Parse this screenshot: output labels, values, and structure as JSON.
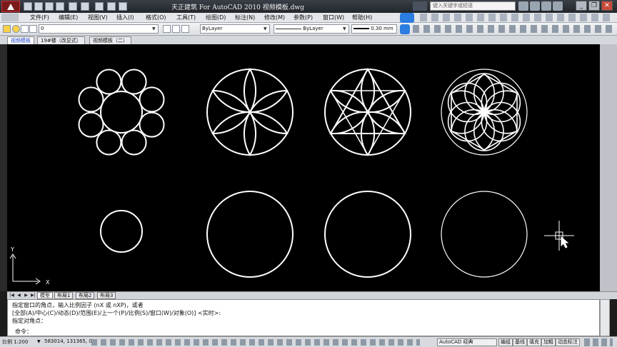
{
  "window": {
    "title": "天正建筑 For AutoCAD 2010   视频模板.dwg",
    "search_placeholder": "键入关键字或短语",
    "controls": {
      "minimize": "_",
      "restore": "❐",
      "close": "✕"
    }
  },
  "menu": [
    "文件(F)",
    "编辑(E)",
    "视图(V)",
    "插入(I)",
    "格式(O)",
    "工具(T)",
    "绘图(D)",
    "标注(N)",
    "修改(M)",
    "参数(P)",
    "窗口(W)",
    "帮助(H)"
  ],
  "toolbar": {
    "layer_value": "0",
    "color_value": "ByLayer",
    "linetype_value": "ByLayer",
    "lineweight_value": "0.30 mm"
  },
  "doc_tabs": [
    "视频模板",
    "19#楼（改显式）",
    "视频模板（二）"
  ],
  "layout_tabs": [
    "模型",
    "布局1",
    "布局2",
    "布局3"
  ],
  "ucs": {
    "x_label": "X",
    "y_label": "Y"
  },
  "command": {
    "lines": [
      "指定窗口的角点，输入比例因子 (nX 或 nXP)，或者",
      "[全部(A)/中心(C)/动态(D)/范围(E)/上一个(P)/比例(S)/窗口(W)/对象(O)] <实时>:",
      "指定对角点："
    ],
    "prompt": "命令："
  },
  "status": {
    "scale": "比例 1:200",
    "coords": "583014, 131365, 0",
    "workspace": "AutoCAD 经典",
    "buttons": [
      "编组",
      "基线",
      "填充",
      "加粗",
      "动态标注"
    ]
  },
  "colors": {
    "canvas": "#000000",
    "lines": "#ffffff",
    "active_tab": "#1a3fc8"
  }
}
